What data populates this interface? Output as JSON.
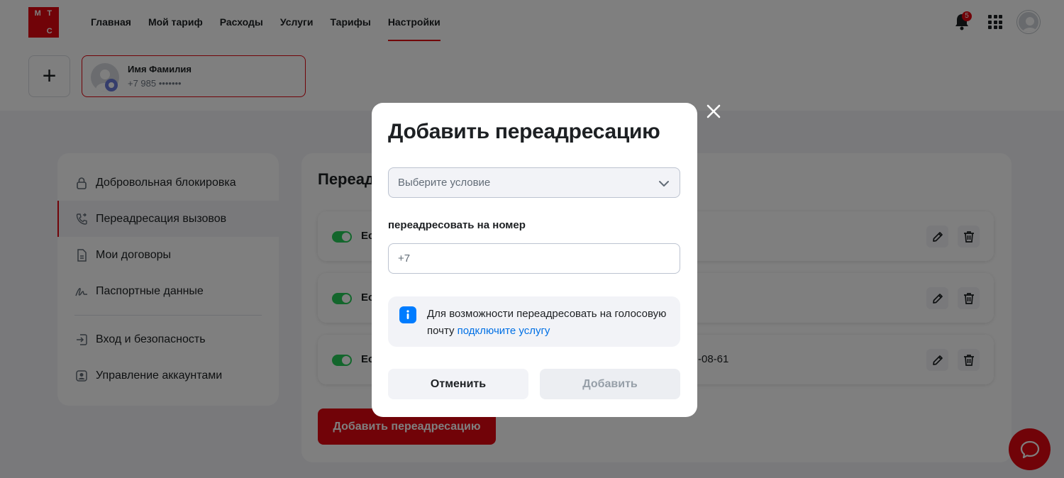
{
  "header": {
    "logo_letters": [
      "М",
      "Т",
      "С"
    ],
    "nav": [
      {
        "label": "Главная",
        "active": false
      },
      {
        "label": "Мой тариф",
        "active": false
      },
      {
        "label": "Расходы",
        "active": false
      },
      {
        "label": "Услуги",
        "active": false
      },
      {
        "label": "Тарифы",
        "active": false
      },
      {
        "label": "Настройки",
        "active": true
      }
    ],
    "notifications_count": "5",
    "icons": [
      "bell-icon",
      "apps-grid-icon",
      "user-avatar"
    ]
  },
  "account": {
    "add_label": "+",
    "name": "Имя Фамилия",
    "phone": "+7 985 •••••••"
  },
  "sidebar": {
    "items": [
      {
        "label": "Добровольная блокировка",
        "icon": "lock-icon"
      },
      {
        "label": "Переадресация вызовов",
        "icon": "call-forward-icon",
        "active": true
      },
      {
        "label": "Мои договоры",
        "icon": "document-icon"
      },
      {
        "label": "Паспортные данные",
        "icon": "signature-icon"
      },
      {
        "label": "Вход и безопасность",
        "icon": "login-icon"
      },
      {
        "label": "Управление аккаунтами",
        "icon": "account-icon"
      }
    ]
  },
  "main": {
    "title": "Переадресация вызовов",
    "rows": [
      {
        "label": "Если ...",
        "number": ""
      },
      {
        "label": "Если ...",
        "number": ""
      },
      {
        "label": "Если ...",
        "number": "-08-61"
      }
    ],
    "add_button": "Добавить переадресацию"
  },
  "modal": {
    "title": "Добавить переадресацию",
    "select_placeholder": "Выберите условие",
    "field_label": "переадресовать на номер",
    "phone_prefix": "+7",
    "info_text": "Для возможности переадресовать на голосовую почту",
    "info_link": "подключите услугу",
    "cancel": "Отменить",
    "add": "Добавить"
  },
  "colors": {
    "brand": "#e30611",
    "toggle_on": "#26cd58",
    "link": "#0070e5",
    "info_icon": "#007cff"
  }
}
